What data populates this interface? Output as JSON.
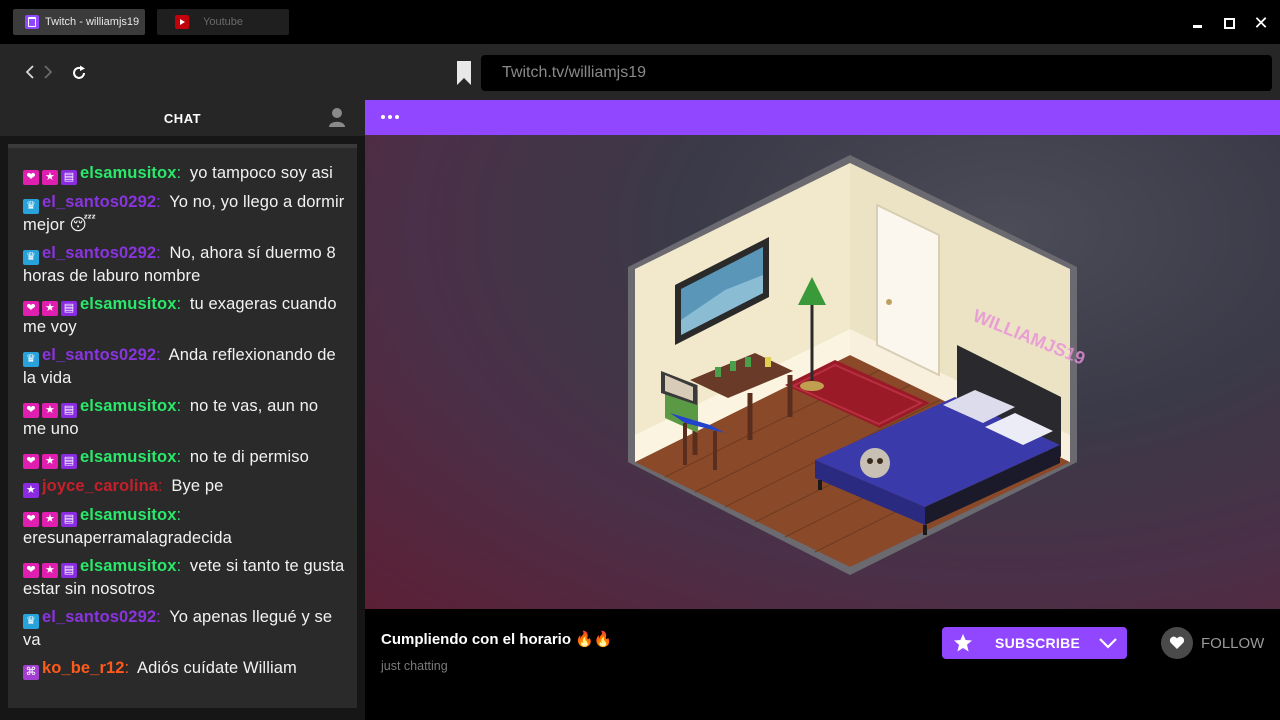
{
  "tabs": [
    {
      "label": "Twitch - williamjs19",
      "active": true
    },
    {
      "label": "Youtube",
      "active": false
    }
  ],
  "nav": {
    "url": "Twitch.tv/williamjs19"
  },
  "chat": {
    "header": "CHAT",
    "messages": [
      {
        "badges": [
          "heart",
          "star",
          "book"
        ],
        "user": "elsamusitox",
        "color": "green",
        "text": "yo tampoco soy asi"
      },
      {
        "badges": [
          "crown"
        ],
        "user": "el_santos0292",
        "color": "purple",
        "text": "Yo no, yo llego a dormir mejor 😴"
      },
      {
        "badges": [
          "crown"
        ],
        "user": "el_santos0292",
        "color": "purple",
        "text": "No, ahora sí duermo 8 horas de laburo nombre"
      },
      {
        "badges": [
          "heart",
          "star",
          "book"
        ],
        "user": "elsamusitox",
        "color": "green",
        "text": "tu exageras cuando me voy"
      },
      {
        "badges": [
          "crown"
        ],
        "user": "el_santos0292",
        "color": "purple",
        "text": "Anda reflexionando de la vida"
      },
      {
        "badges": [
          "heart",
          "star",
          "book"
        ],
        "user": "elsamusitox",
        "color": "green",
        "text": "no te vas, aun no me uno"
      },
      {
        "badges": [
          "heart",
          "star",
          "book"
        ],
        "user": "elsamusitox",
        "color": "green",
        "text": "no te di permiso"
      },
      {
        "badges": [
          "pstar"
        ],
        "user": "joyce_carolina",
        "color": "red",
        "text": "Bye pe"
      },
      {
        "badges": [
          "heart",
          "star",
          "book"
        ],
        "user": "elsamusitox",
        "color": "green",
        "text": "eresunaperramalagradecida"
      },
      {
        "badges": [
          "heart",
          "star",
          "book"
        ],
        "user": "elsamusitox",
        "color": "green",
        "text": "vete si tanto te gusta estar sin nosotros"
      },
      {
        "badges": [
          "crown"
        ],
        "user": "el_santos0292",
        "color": "purple",
        "text": "Yo apenas llegué y se va"
      },
      {
        "badges": [
          "sub"
        ],
        "user": "ko_be_r12",
        "color": "orange",
        "text": "Adiós cuídate William"
      }
    ]
  },
  "stream": {
    "title": "Cumpliendo con el horario 🔥🔥",
    "category": "just chatting",
    "overlay_name": "WILLIAMJS19",
    "subscribe_label": "SUBSCRIBE",
    "follow_label": "FOLLOW"
  },
  "colors": {
    "accent": "#9146ff",
    "green": "#2ae86a",
    "purple": "#8a34e0",
    "red": "#c4202a",
    "orange": "#ff5a1a"
  }
}
